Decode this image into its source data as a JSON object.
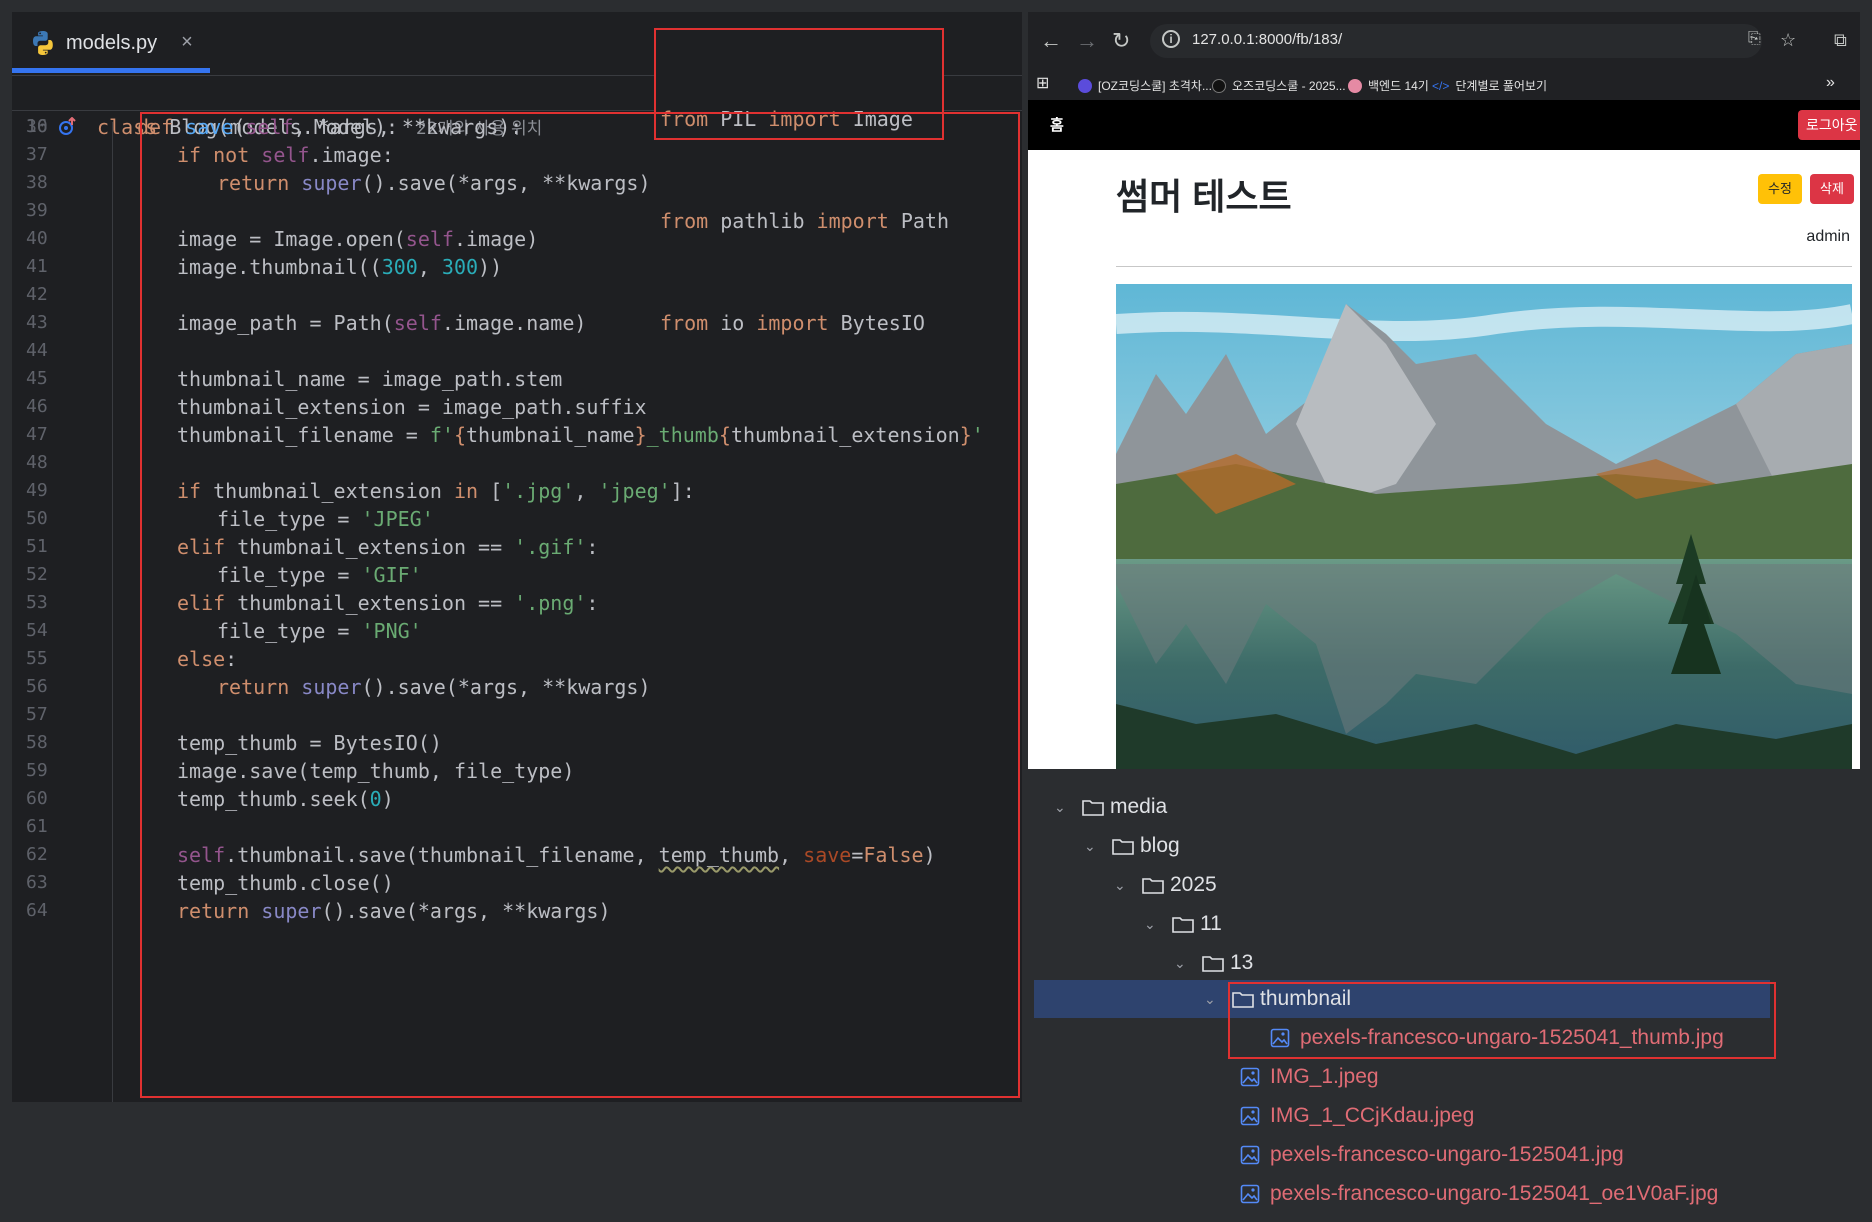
{
  "editor": {
    "tab_label": "models.py",
    "tab_close": "×",
    "header_line": {
      "num": "10",
      "usage": "22개의 사용 위치"
    },
    "imports": [
      "from PIL import Image",
      "from pathlib import Path",
      "from io import BytesIO"
    ],
    "line_numbers": [
      "36",
      "37",
      "38",
      "39",
      "40",
      "41",
      "42",
      "43",
      "44",
      "45",
      "46",
      "47",
      "48",
      "49",
      "50",
      "51",
      "52",
      "53",
      "54",
      "55",
      "56",
      "57",
      "58",
      "59",
      "60",
      "61",
      "62",
      "63",
      "64"
    ]
  },
  "browser": {
    "url": "127.0.0.1:8000/fb/183/",
    "bookmarks": [
      "[OZ코딩스쿨] 초격차...",
      "오즈코딩스쿨 - 2025...",
      "백엔드 14기",
      "단계별로 풀어보기"
    ],
    "bookmark_more": "»",
    "nav_home": "홈",
    "logout_label": "로그아웃",
    "post_title": "썸머 테스트",
    "edit_label": "수정",
    "delete_label": "삭제",
    "author": "admin"
  },
  "tree": {
    "folders": [
      "media",
      "blog",
      "2025",
      "11",
      "13",
      "thumbnail"
    ],
    "thumb_file": "pexels-francesco-ungaro-1525041_thumb.jpg",
    "files": [
      "IMG_1.jpeg",
      "IMG_1_CCjKdau.jpeg",
      "pexels-francesco-ungaro-1525041.jpg",
      "pexels-francesco-ungaro-1525041_oe1V0aF.jpg"
    ]
  },
  "colors": {
    "accent": "#3574f0",
    "highlight_box": "#e03131",
    "delete": "#dc3545",
    "edit": "#ffc107"
  }
}
